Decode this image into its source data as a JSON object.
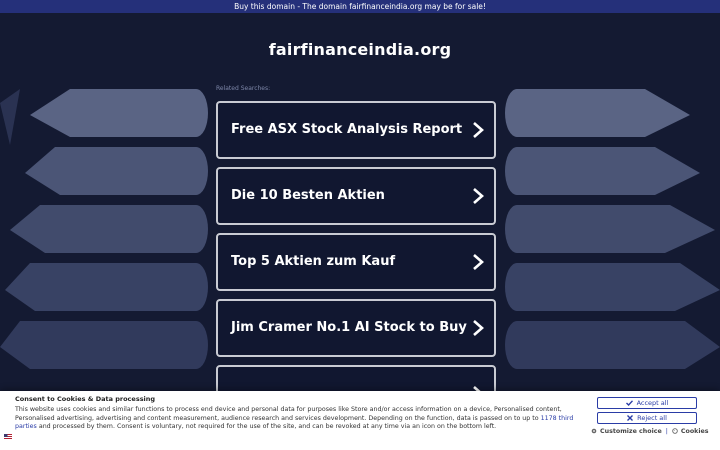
{
  "banner": {
    "text": "Buy this domain - The domain fairfinanceindia.org may be for sale!"
  },
  "header": {
    "domain": "fairfinanceindia.org"
  },
  "related": {
    "heading": "Related Searches:",
    "items": [
      {
        "label": "Free ASX Stock Analysis Report"
      },
      {
        "label": "Die 10 Besten Aktien"
      },
      {
        "label": "Top 5 Aktien zum Kauf"
      },
      {
        "label": "Jim Cramer No.1 AI Stock to Buy"
      }
    ]
  },
  "consent": {
    "title": "Consent to Cookies & Data processing",
    "text_before": "This website uses cookies and similar functions to process end device and personal data for purposes like Store and/or access information on a device, Personalised content, Personalised advertising, advertising and content measurement, audience research and services development. Depending on the function, data is passed on to up to ",
    "link_text": "1178 third parties",
    "text_after": " and processed by them. Consent is voluntary, not required for the use of the site, and can be revoked at any time via an icon on the bottom left.",
    "accept_label": "Accept all",
    "reject_label": "Reject all",
    "customize_label": "Customize choice",
    "separator": "|",
    "cookies_label": "Cookies"
  },
  "colors": {
    "background": "#141a32",
    "banner": "#25307a",
    "card_border": "#c9cbd3",
    "consent_accent": "#2a3ca6"
  },
  "icons": {
    "card_arrow": "chevron-right-icon",
    "accept": "check-icon",
    "reject": "x-icon",
    "customize": "gear-icon",
    "cookies": "cookie-icon",
    "language": "us-flag-icon"
  }
}
